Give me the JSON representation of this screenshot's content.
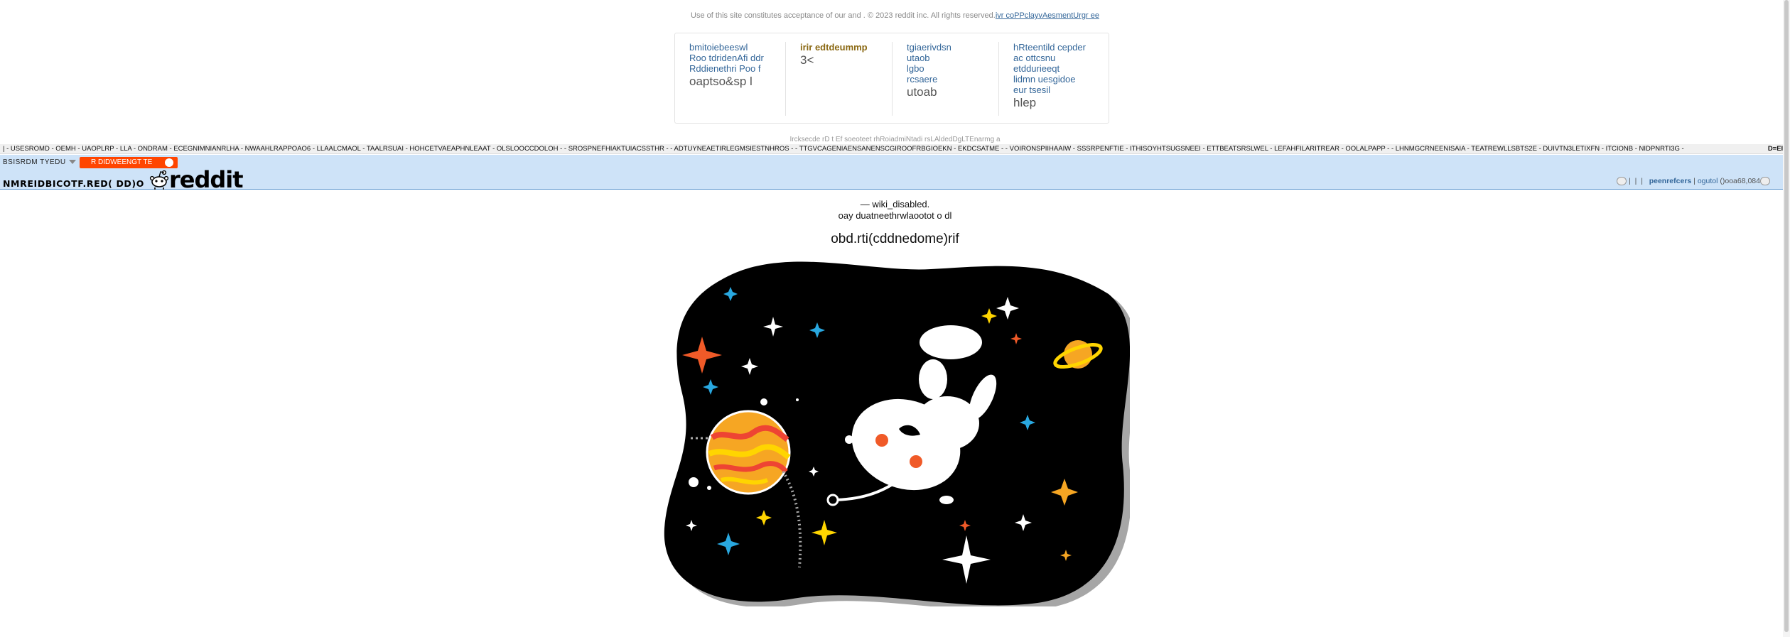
{
  "legal": {
    "text": "Use of this site constitutes acceptance of our and . © 2023 reddit inc. All rights reserved.",
    "link": "ivr coPPclayvAesmentUrgr ee"
  },
  "footer": {
    "col1": [
      "bmitoiebeeswl",
      "Roo tdridenAfi ddr",
      "Rddienethri Poo f"
    ],
    "col1_big": "oaptso&sp l",
    "col2_head": "irir edtdeummp",
    "col2_big": "3<",
    "col3": [
      "tgiaerivdsn",
      "utaob",
      "lgbo",
      "rcsaere"
    ],
    "col3_big": "utoab",
    "col4": [
      "hRteentild cepder",
      "ac ottcsnu",
      "etddurieeqt",
      "lidmn uesgidoe",
      "eur tsesil"
    ],
    "col4_big": "hlep"
  },
  "tagline_small": "Ircksecde rD t Ef soeoteet rhRoiadmiNtadi rsLAldedDgLTEnarmg a",
  "srbar": {
    "items": "| - USESROMD - OEMH - UAOPLRP - LLA - ONDRAM - ECEGNIMNIANRLHA - NWAAHLRAPPOAO6 - LLAALCMAOL - TAALRSUAI - HOHCETVAEAPHNLEAAT - OLSLOOCCDOLOH - - SROSPNEFHIAKTUIACSSTHR - - ADTUYNEAETIRLEGMSIESTNHROS - - TTGVCAGENIAENSANENSCGIROOFRBGIOEKN - EKDCSATME - - VOIRONSPIIHAAIW - SSSRPENFTIE - ITHISOYHTSUGSNEEI - ETTBEATSRSLWEL - LEFAHFILARITREAR - OOLALPAPP - - LHNMGCRNEENISAIA - TEATREWLLSBTS2E - DUIVTN3LETIXFN - ITCIONB - NIDPNRTI3G -",
    "more": "D=EIT"
  },
  "header": {
    "my_subreddits": "BSISRDM TYEDU",
    "red_button": "R DIDWEENGT TE",
    "page_name": "NMREIDBICOTF.RED( DD)O",
    "wordmark": "reddit",
    "user": "peenrefcers",
    "logout": "ogutol",
    "karma": "()ooa68,084"
  },
  "content": {
    "line1": "— wiki_disabled.",
    "line2": "oay duatneethrwlaootot o dl",
    "title": "obd.rti(cddnedome)rif"
  },
  "colors": {
    "header_bg": "#cee3f8",
    "accent_orange": "#ff4500",
    "link": "#336699"
  }
}
